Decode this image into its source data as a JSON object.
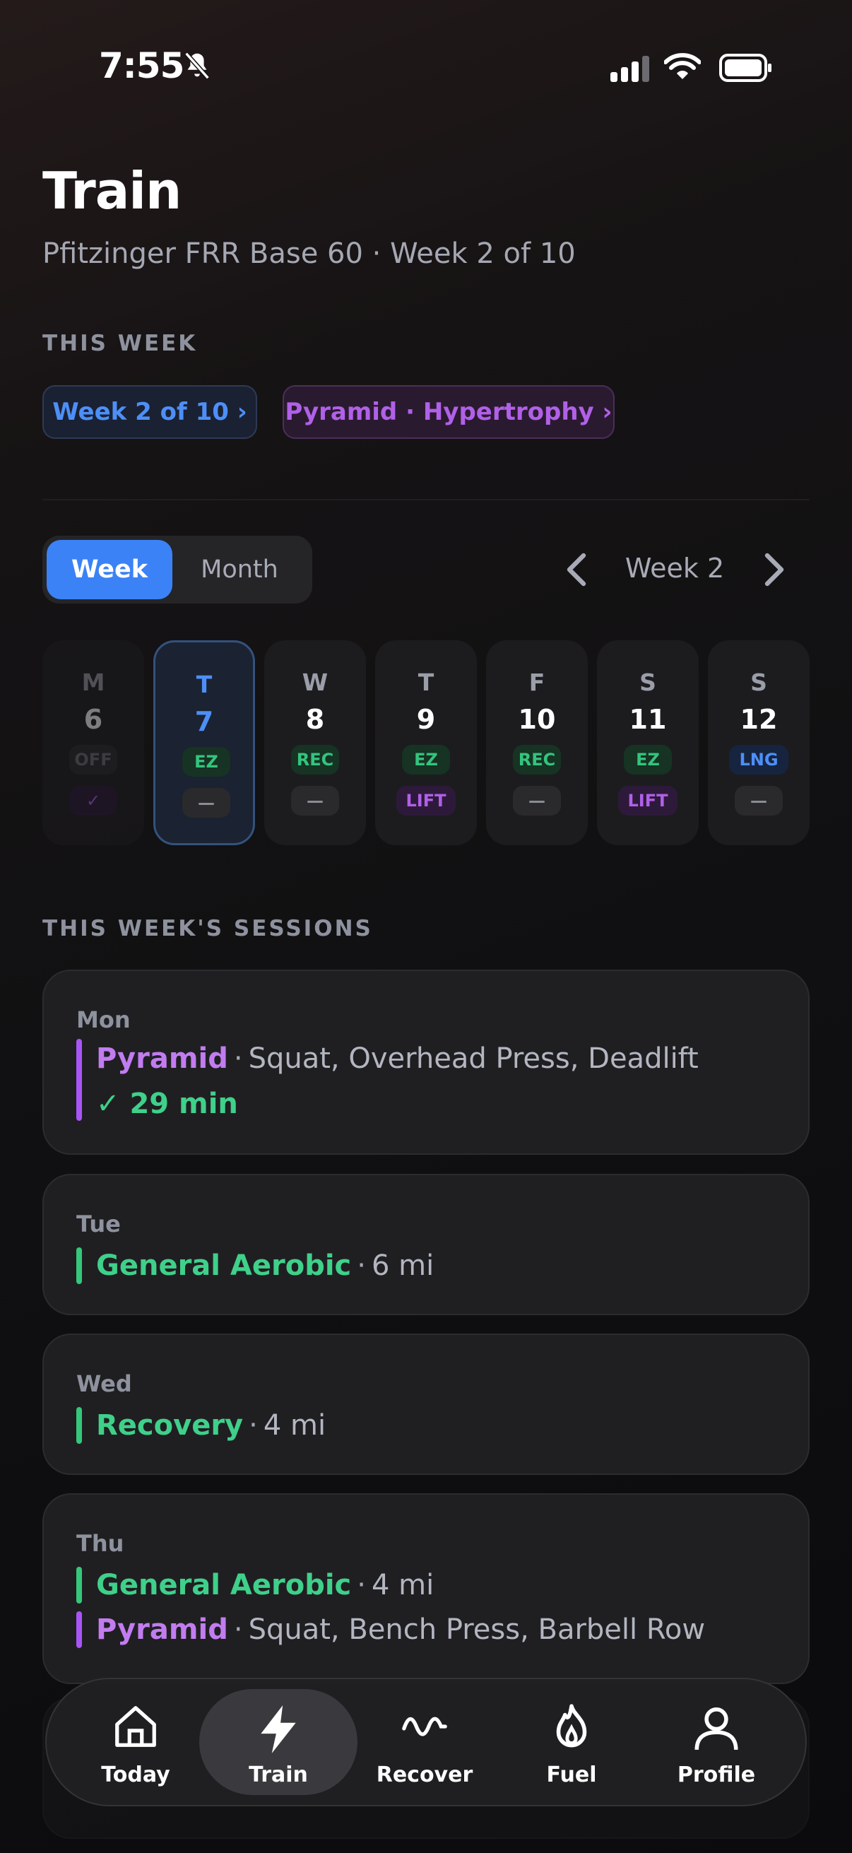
{
  "status_bar": {
    "time": "7:55"
  },
  "header": {
    "title": "Train",
    "subtitle": "Pfitzinger FRR Base 60 · Week 2 of 10"
  },
  "this_week": {
    "label": "THIS WEEK",
    "chips": {
      "week": "Week 2 of 10 ›",
      "program": "Pyramid · Hypertrophy ›"
    }
  },
  "view_toggle": {
    "week": "Week",
    "month": "Month",
    "selected": "Week"
  },
  "week_nav": {
    "label": "Week 2"
  },
  "days": [
    {
      "letter": "M",
      "num": "6",
      "run": "OFF",
      "lift": "✓"
    },
    {
      "letter": "T",
      "num": "7",
      "run": "EZ",
      "lift": "—"
    },
    {
      "letter": "W",
      "num": "8",
      "run": "REC",
      "lift": "—"
    },
    {
      "letter": "T",
      "num": "9",
      "run": "EZ",
      "lift": "LIFT"
    },
    {
      "letter": "F",
      "num": "10",
      "run": "REC",
      "lift": "—"
    },
    {
      "letter": "S",
      "num": "11",
      "run": "EZ",
      "lift": "LIFT"
    },
    {
      "letter": "S",
      "num": "12",
      "run": "LNG",
      "lift": "—"
    }
  ],
  "sessions": {
    "label": "THIS WEEK'S SESSIONS",
    "mon": {
      "day": "Mon",
      "name": "Pyramid",
      "detail": "Squat, Overhead Press, Deadlift",
      "done": "✓ 29 min"
    },
    "tue": {
      "day": "Tue",
      "name": "General Aerobic",
      "detail": "6 mi"
    },
    "wed": {
      "day": "Wed",
      "name": "Recovery",
      "detail": "4 mi"
    },
    "thu": {
      "day": "Thu",
      "run_name": "General Aerobic",
      "run_detail": "4 mi",
      "lift_name": "Pyramid",
      "lift_detail": "Squat, Bench Press, Barbell Row"
    },
    "separator": "·"
  },
  "tabbar": {
    "today": "Today",
    "train": "Train",
    "recover": "Recover",
    "fuel": "Fuel",
    "profile": "Profile",
    "active": "Train"
  },
  "colors": {
    "accent_blue": "#3b82f6",
    "run_green": "#34c77b",
    "lift_purple": "#a855f7"
  }
}
